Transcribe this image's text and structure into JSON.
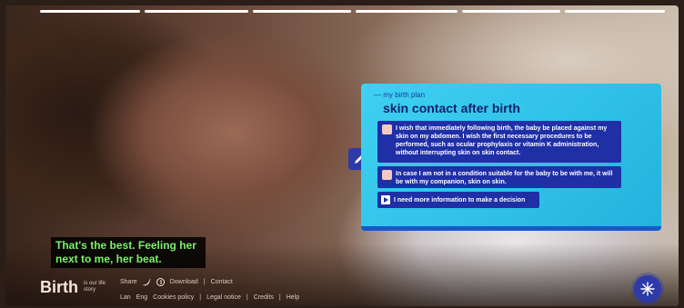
{
  "progress": {
    "segments": 6,
    "completed": 6
  },
  "subtitle": {
    "text": "That's the best. Feeling her next to me, her beat."
  },
  "panel": {
    "breadcrumb": "— my birth plan",
    "title": "skin contact after birth",
    "options": [
      {
        "text": "I wish that immediately following birth, the baby be placed against my skin on my abdomen. I wish the first necessary procedures to be performed, such as ocular prophylaxis or vitamin K administration, without interrupting skin on skin contact."
      },
      {
        "text": "In case I am not in a condition suitable for the baby to be with me, it will be with my companion, skin on skin."
      }
    ],
    "more_info": "I need more information to make a decision"
  },
  "footer": {
    "logo": "Birth",
    "logo_sub": "is our life story",
    "share_label": "Share",
    "row1_links": [
      "Download",
      "Contact"
    ],
    "lang_label": "Lan",
    "lang_value": "Eng",
    "row2_links": [
      "Cookies policy",
      "Legal notice",
      "Credits",
      "Help"
    ]
  },
  "colors": {
    "panel": "#2ec0e6",
    "option": "#1f2fa6",
    "subtitle_text": "#7cf06b",
    "accent": "#2d3aa8"
  },
  "icons": {
    "edit": "pencil-icon",
    "fab": "snowflake-icon",
    "twitter": "twitter-icon",
    "facebook": "facebook-icon"
  }
}
